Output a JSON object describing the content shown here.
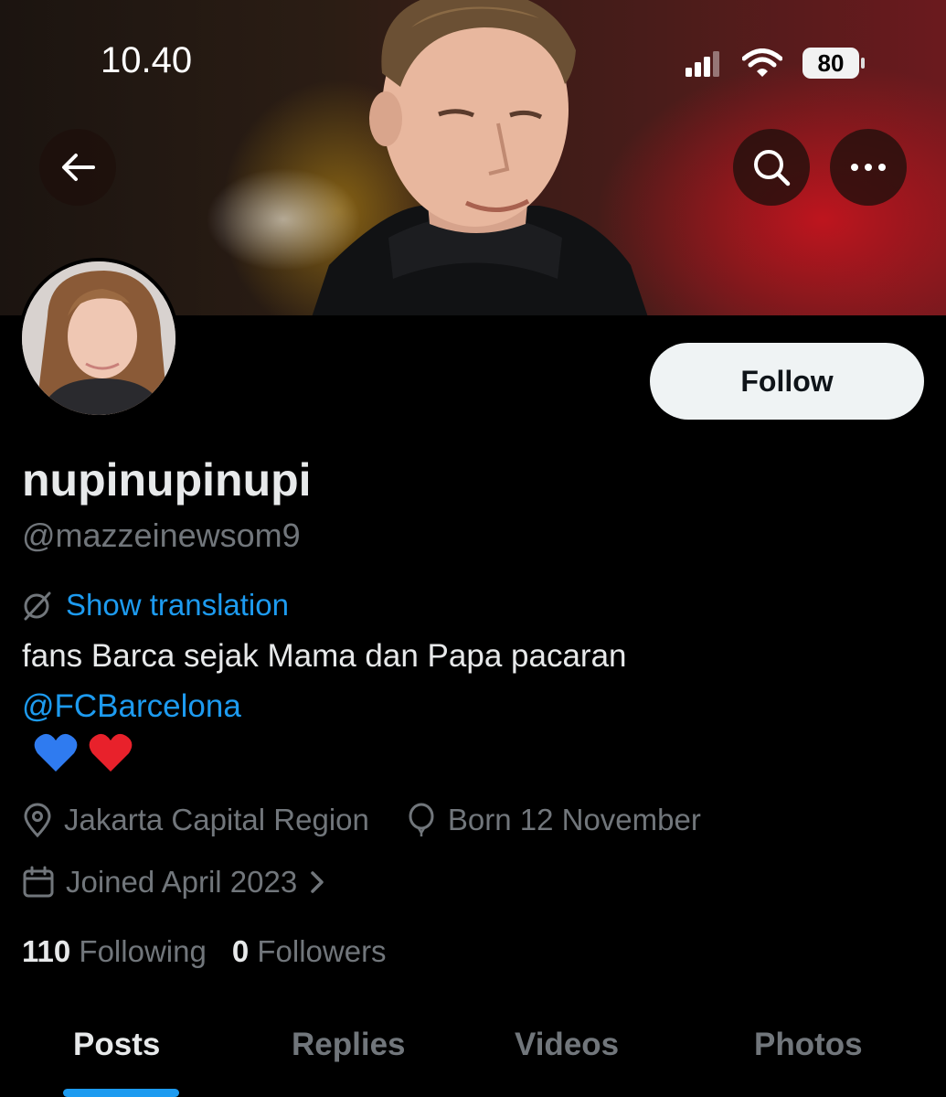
{
  "status_bar": {
    "time": "10.40",
    "battery": "80"
  },
  "header": {
    "icons": [
      "back-arrow-icon",
      "search-icon",
      "more-icon"
    ]
  },
  "profile": {
    "display_name": "nupinupinupi",
    "handle": "@mazzeinewsom9",
    "follow_label": "Follow",
    "translate_label": "Show translation",
    "bio_text": "fans Barca sejak Mama dan Papa pacaran",
    "bio_mention": "@FCBarcelona",
    "bio_emoji": "💙❤️",
    "location": "Jakarta Capital Region",
    "birthday": "Born 12 November",
    "joined": "Joined April 2023"
  },
  "stats": {
    "following_count": "110",
    "following_label": "Following",
    "followers_count": "0",
    "followers_label": "Followers"
  },
  "tabs": [
    {
      "label": "Posts",
      "active": true
    },
    {
      "label": "Replies",
      "active": false
    },
    {
      "label": "Videos",
      "active": false
    },
    {
      "label": "Photos",
      "active": false
    }
  ],
  "colors": {
    "accent": "#1d9bf0",
    "background": "#000000",
    "muted_text": "#71767b",
    "primary_text": "#e7e9ea",
    "follow_button_bg": "#eff3f4"
  }
}
